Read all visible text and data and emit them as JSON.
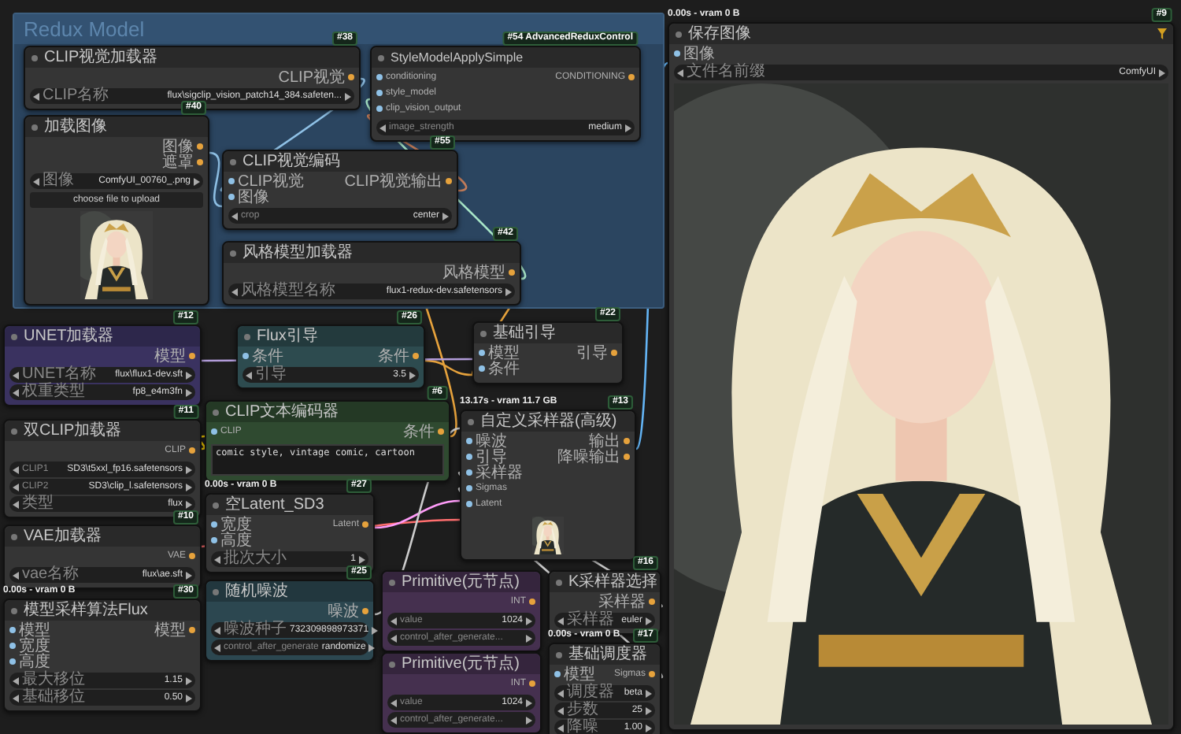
{
  "group": {
    "title": "Redux Model",
    "nodes": [
      {
        "title": "CLIP视觉加载器",
        "badge": "#38",
        "outputs": [
          "CLIP视觉"
        ],
        "widgets": [
          {
            "label": "CLIP名称",
            "value": "flux\\sigclip_vision_patch14_384.safeten..."
          }
        ]
      },
      {
        "title": "StyleModelApplySimple",
        "badge": "#54 AdvancedReduxControl",
        "inputs": [
          "conditioning",
          "style_model",
          "clip_vision_output"
        ],
        "outputs": [
          "CONDITIONING"
        ],
        "widgets": [
          {
            "label": "image_strength",
            "value": "medium"
          }
        ]
      },
      {
        "title": "加载图像",
        "badge": "#40",
        "outputs": [
          "图像",
          "遮罩"
        ],
        "widgets": [
          {
            "label": "图像",
            "value": "ComfyUI_00760_.png"
          }
        ],
        "button": "choose file to upload",
        "preview": {
          "kind": "picture"
        }
      },
      {
        "title": "CLIP视觉编码",
        "badge": "#55",
        "inputs": [
          "CLIP视觉",
          "图像"
        ],
        "outputs": [
          "CLIP视觉输出"
        ],
        "widgets": [
          {
            "label": "crop",
            "value": "center"
          }
        ]
      },
      {
        "title": "风格模型加载器",
        "badge": "#42",
        "outputs": [
          "风格模型"
        ],
        "widgets": [
          {
            "label": "风格模型名称",
            "value": "flux1-redux-dev.safetensors"
          }
        ]
      }
    ]
  },
  "nodes": [
    {
      "title": "UNET加载器",
      "badge": "#12",
      "color": "#3a3260",
      "outputs": [
        "模型"
      ],
      "widgets": [
        {
          "label": "UNET名称",
          "value": "flux\\flux1-dev.sft"
        },
        {
          "label": "权重类型",
          "value": "fp8_e4m3fn"
        }
      ]
    },
    {
      "title": "Flux引导",
      "badge": "#26",
      "color": "#2d4b4f",
      "inputs": [
        "条件"
      ],
      "outputs": [
        "条件"
      ],
      "widgets": [
        {
          "label": "引导",
          "value": "3.5"
        }
      ]
    },
    {
      "title": "基础引导",
      "badge": "#22",
      "inputs": [
        "模型",
        "条件"
      ],
      "outputs": [
        "引导"
      ]
    },
    {
      "title": "双CLIP加载器",
      "badge": "#11",
      "outputs": [
        "CLIP"
      ],
      "widgets": [
        {
          "label": "CLIP1",
          "value": "SD3\\t5xxl_fp16.safetensors"
        },
        {
          "label": "CLIP2",
          "value": "SD3\\clip_l.safetensors"
        },
        {
          "label": "类型",
          "value": "flux"
        }
      ]
    },
    {
      "title": "CLIP文本编码器",
      "badge": "#6",
      "color": "#2f4a30",
      "inputs": [
        "CLIP"
      ],
      "outputs": [
        "条件"
      ],
      "prompt": "comic style, vintage comic, cartoon"
    },
    {
      "title": "自定义采样器(高级)",
      "badge": "#13",
      "header": "13.17s - vram 11.7 GB",
      "inputs": [
        "噪波",
        "引导",
        "采样器",
        "Sigmas",
        "Latent"
      ],
      "outputs": [
        "输出",
        "降噪输出"
      ],
      "preview": {
        "kind": "picture"
      }
    },
    {
      "title": "VAE加载器",
      "badge": "#10",
      "outputs": [
        "VAE"
      ],
      "widgets": [
        {
          "label": "vae名称",
          "value": "flux\\ae.sft"
        }
      ]
    },
    {
      "title": "空Latent_SD3",
      "badge": "#27",
      "header": "0.00s - vram 0 B",
      "inputs": [
        "宽度",
        "高度"
      ],
      "outputs": [
        "Latent"
      ],
      "widgets": [
        {
          "label": "批次大小",
          "value": "1"
        }
      ]
    },
    {
      "title": "随机噪波",
      "badge": "#25",
      "color": "#2c4750",
      "outputs": [
        "噪波"
      ],
      "widgets": [
        {
          "label": "噪波种子",
          "value": "732309898973371"
        },
        {
          "label": "control_after_generate",
          "value": "randomize"
        }
      ]
    },
    {
      "title": "Primitive(元节点)",
      "color": "#45304f",
      "outputs": [
        "INT"
      ],
      "widgets": [
        {
          "label": "value",
          "value": "1024"
        },
        {
          "label": "control_after_generate..."
        }
      ]
    },
    {
      "title": "K采样器选择",
      "badge": "#16",
      "outputs": [
        "采样器"
      ],
      "widgets": [
        {
          "label": "采样器",
          "value": "euler"
        }
      ]
    },
    {
      "title": "模型采样算法Flux",
      "badge": "#30",
      "header": "0.00s - vram 0 B",
      "inputs": [
        "模型",
        "宽度",
        "高度"
      ],
      "outputs": [
        "模型"
      ],
      "widgets": [
        {
          "label": "最大移位",
          "value": "1.15"
        },
        {
          "label": "基础移位",
          "value": "0.50"
        }
      ]
    },
    {
      "title": "Primitive(元节点)",
      "color": "#45304f",
      "outputs": [
        "INT"
      ],
      "widgets": [
        {
          "label": "value",
          "value": "1024"
        },
        {
          "label": "control_after_generate..."
        }
      ]
    },
    {
      "title": "基础调度器",
      "badge": "#17",
      "header": "0.00s - vram 0 B",
      "inputs": [
        "模型"
      ],
      "outputs": [
        "Sigmas"
      ],
      "widgets": [
        {
          "label": "调度器",
          "value": "beta"
        },
        {
          "label": "步数",
          "value": "25"
        },
        {
          "label": "降噪",
          "value": "1.00"
        }
      ]
    },
    {
      "title": "保存图像",
      "badge": "#9",
      "header": "0.00s - vram 0 B",
      "inputs": [
        "图像"
      ],
      "widgets": [
        {
          "label": "文件名前缀",
          "value": "ComfyUI"
        }
      ],
      "preview": {
        "kind": "picture"
      },
      "menu": true
    }
  ]
}
